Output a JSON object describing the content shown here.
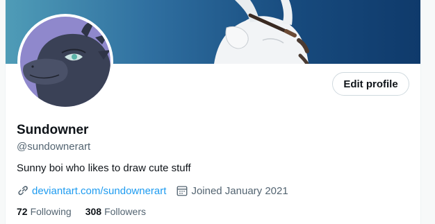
{
  "profile": {
    "display_name": "Sundowner",
    "handle": "@sundownerart",
    "bio": "Sunny boi who likes to draw cute stuff",
    "website": "deviantart.com/sundownerart",
    "joined": "Joined January 2021",
    "following_count": "72",
    "following_label": "Following",
    "followers_count": "308",
    "followers_label": "Followers"
  },
  "actions": {
    "edit_profile_label": "Edit profile"
  },
  "icons": {
    "link": "link-icon",
    "calendar": "calendar-icon"
  },
  "colors": {
    "link": "#1d9bf0",
    "secondary_text": "#536471",
    "primary_text": "#0f1419"
  }
}
